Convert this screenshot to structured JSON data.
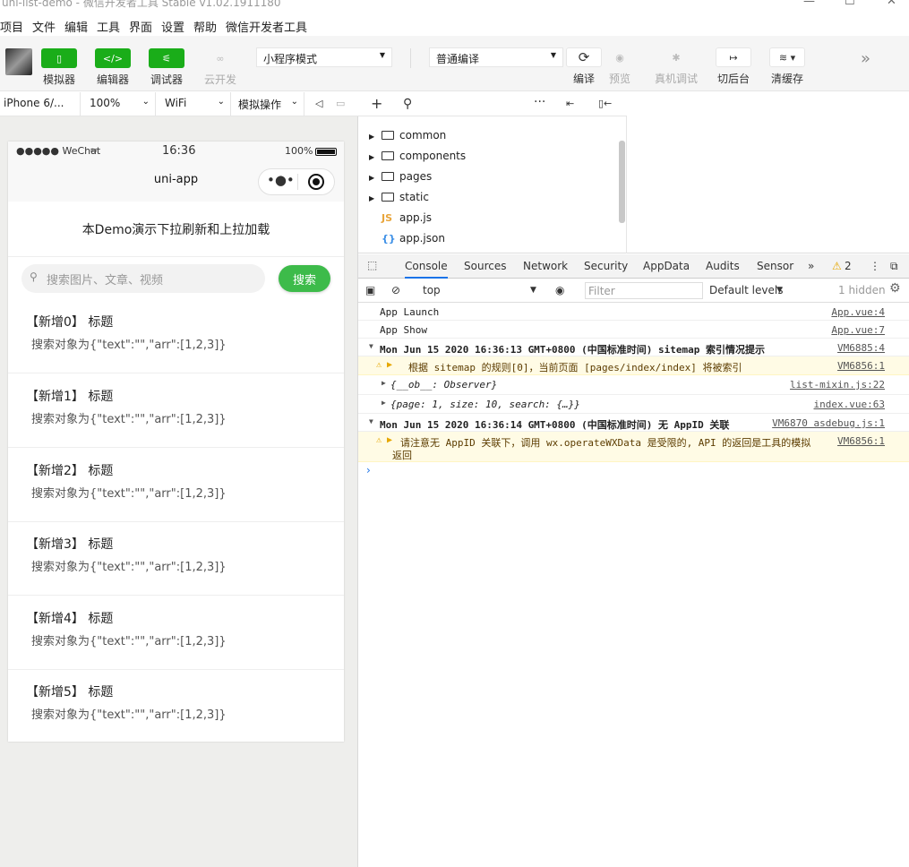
{
  "window": {
    "title": "uni-list-demo - 微信开发者工具 Stable v1.02.1911180",
    "minimize": "—",
    "maximize": "☐",
    "close": "✕"
  },
  "menu": [
    "项目",
    "文件",
    "编辑",
    "工具",
    "界面",
    "设置",
    "帮助",
    "微信开发者工具"
  ],
  "toolbar": {
    "simulator": "模拟器",
    "editor": "编辑器",
    "debugger": "调试器",
    "cloud": "云开发",
    "mode": "小程序模式",
    "compile_mode": "普通编译",
    "compile": "编译",
    "preview": "预览",
    "remote_debug": "真机调试",
    "background": "切后台",
    "clear_cache": "清缓存"
  },
  "devbar": {
    "device": "iPhone 6/...",
    "zoom": "100%",
    "network": "WiFi",
    "simulate": "模拟操作"
  },
  "phone": {
    "carrier": "●●●●● WeChat",
    "time": "16:36",
    "battery": "100%",
    "nav_title": "uni-app",
    "demo_text": "本Demo演示下拉刷新和上拉加载",
    "search_placeholder": "搜索图片、文章、视频",
    "search_button": "搜索",
    "items": [
      {
        "title": "【新增0】 标题",
        "desc": "搜索对象为{\"text\":\"\",\"arr\":[1,2,3]}"
      },
      {
        "title": "【新增1】 标题",
        "desc": "搜索对象为{\"text\":\"\",\"arr\":[1,2,3]}"
      },
      {
        "title": "【新增2】 标题",
        "desc": "搜索对象为{\"text\":\"\",\"arr\":[1,2,3]}"
      },
      {
        "title": "【新增3】 标题",
        "desc": "搜索对象为{\"text\":\"\",\"arr\":[1,2,3]}"
      },
      {
        "title": "【新增4】 标题",
        "desc": "搜索对象为{\"text\":\"\",\"arr\":[1,2,3]}"
      },
      {
        "title": "【新增5】 标题",
        "desc": "搜索对象为{\"text\":\"\",\"arr\":[1,2,3]}"
      }
    ]
  },
  "files": [
    {
      "name": "common",
      "type": "folder"
    },
    {
      "name": "components",
      "type": "folder"
    },
    {
      "name": "pages",
      "type": "folder"
    },
    {
      "name": "static",
      "type": "folder"
    },
    {
      "name": "app.js",
      "type": "js"
    },
    {
      "name": "app.json",
      "type": "json"
    }
  ],
  "devtools": {
    "tabs": [
      "Console",
      "Sources",
      "Network",
      "Security",
      "AppData",
      "Audits",
      "Sensor"
    ],
    "warnings": "2",
    "context": "top",
    "filter_placeholder": "Filter",
    "levels": "Default levels",
    "hidden": "1 hidden"
  },
  "logs": [
    {
      "msg": "App Launch",
      "src": "App.vue:4"
    },
    {
      "msg": "App Show",
      "src": "App.vue:7"
    },
    {
      "msg": "Mon Jun 15 2020 16:36:13 GMT+0800 (中国标准时间) sitemap 索引情况提示",
      "src": "VM6885:4"
    },
    {
      "msg": "根据 sitemap 的规则[0]，当前页面 [pages/index/index] 将被索引",
      "src": "VM6856:1"
    },
    {
      "msg": "{__ob__: Observer}",
      "src": "list-mixin.js:22"
    },
    {
      "msg": "{page: 1, size: 10, search: {…}}",
      "src": "index.vue:63"
    },
    {
      "msg": "Mon Jun 15 2020 16:36:14 GMT+0800 (中国标准时间) 无 AppID 关联",
      "src": "VM6870 asdebug.js:1"
    },
    {
      "msg": "请注意无 AppID 关联下，调用 wx.operateWXData 是受限的, API 的返回是工具的模拟",
      "msg2": "返回",
      "src": "VM6856:1"
    }
  ]
}
